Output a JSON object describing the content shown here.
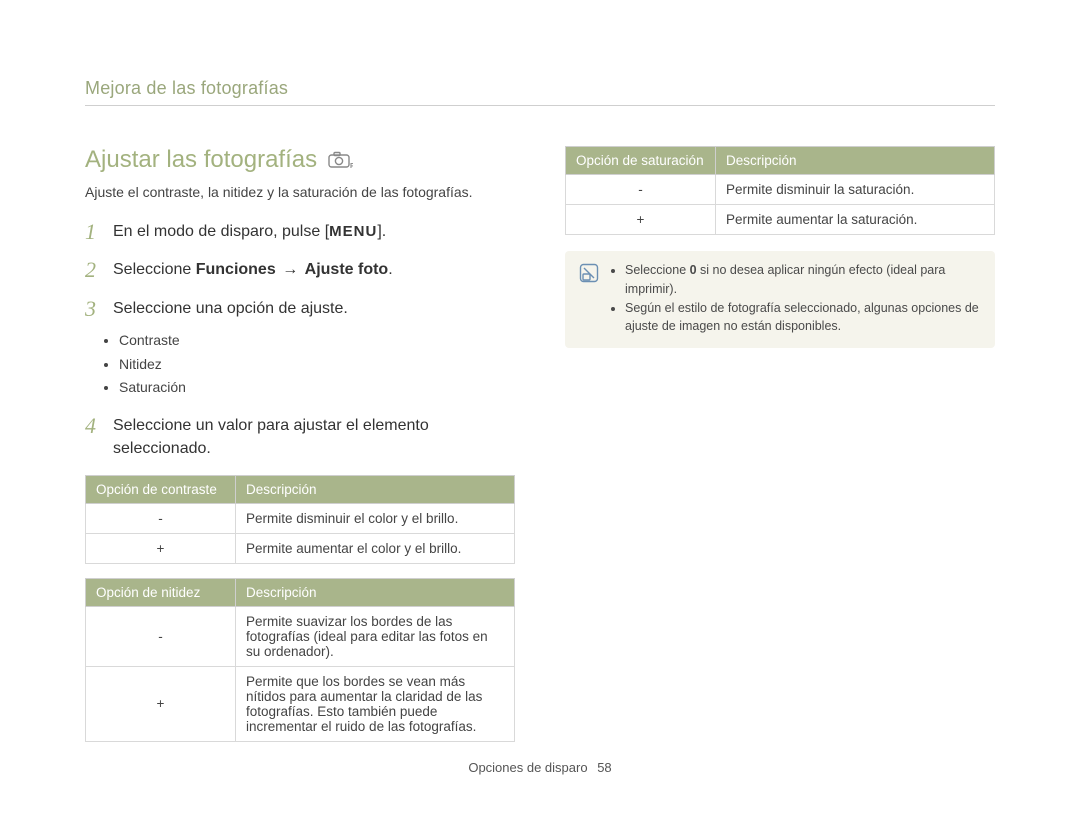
{
  "chapter_title": "Mejora de las fotografías",
  "section": {
    "title": "Ajustar las fotografías",
    "intro": "Ajuste el contraste, la nitidez y la saturación de las fotografías."
  },
  "steps": {
    "s1": {
      "num": "1",
      "prefix": "En el modo de disparo, pulse [",
      "menu": "MENU",
      "suffix": "]."
    },
    "s2": {
      "num": "2",
      "prefix": "Seleccione ",
      "bold1": "Funciones",
      "arrow": "→",
      "bold2": "Ajuste foto",
      "suffix": "."
    },
    "s3": {
      "num": "3",
      "text": "Seleccione una opción de ajuste."
    },
    "s3_bullets": {
      "b1": "Contraste",
      "b2": "Nitidez",
      "b3": "Saturación"
    },
    "s4": {
      "num": "4",
      "text": "Seleccione un valor para ajustar el elemento seleccionado."
    }
  },
  "tables": {
    "contrast": {
      "h1": "Opción de contraste",
      "h2": "Descripción",
      "r1": {
        "sym": "-",
        "desc": "Permite disminuir el color y el brillo."
      },
      "r2": {
        "sym": "+",
        "desc": "Permite aumentar el color y el brillo."
      }
    },
    "sharpness": {
      "h1": "Opción de nitidez",
      "h2": "Descripción",
      "r1": {
        "sym": "-",
        "desc": "Permite suavizar los bordes de las fotografías (ideal para editar las fotos en su ordenador)."
      },
      "r2": {
        "sym": "+",
        "desc": "Permite que los bordes se vean más nítidos para aumentar la claridad de las fotografías. Esto también puede incrementar el ruido de las fotografías."
      }
    },
    "saturation": {
      "h1": "Opción de saturación",
      "h2": "Descripción",
      "r1": {
        "sym": "-",
        "desc": "Permite disminuir la saturación."
      },
      "r2": {
        "sym": "+",
        "desc": "Permite aumentar la saturación."
      }
    }
  },
  "note": {
    "l1a": "Seleccione ",
    "l1b": "0",
    "l1c": " si no desea aplicar ningún efecto (ideal para imprimir).",
    "l2": "Según el estilo de fotografía seleccionado, algunas opciones de ajuste de imagen no están disponibles."
  },
  "footer": {
    "section": "Opciones de disparo",
    "page": "58"
  }
}
